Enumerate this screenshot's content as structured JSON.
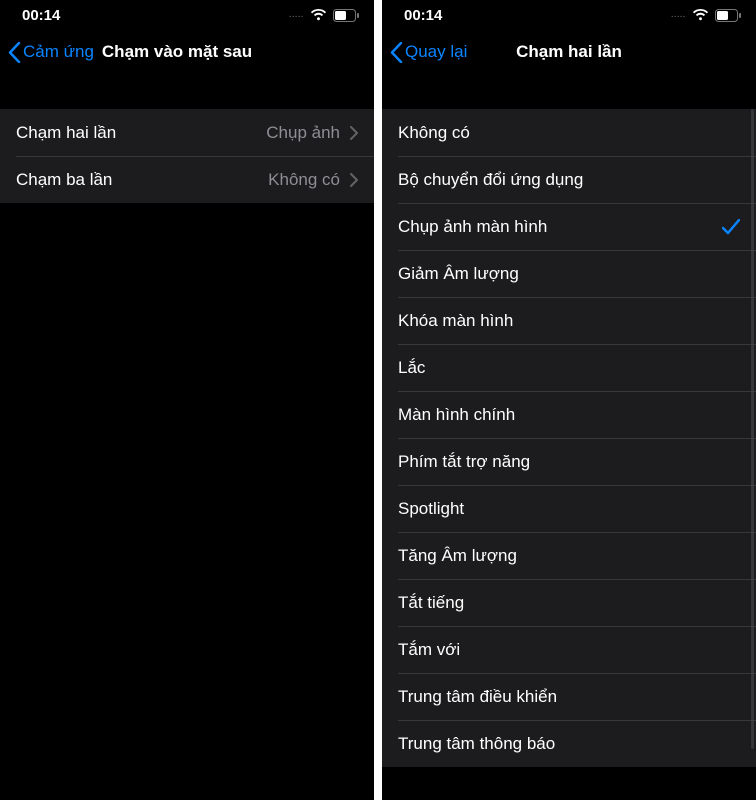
{
  "status": {
    "time": "00:14",
    "dots": "....."
  },
  "screenA": {
    "back_label": "Cảm ứng",
    "title": "Chạm vào mặt sau",
    "rows": [
      {
        "label": "Chạm hai lần",
        "value": "Chụp ảnh"
      },
      {
        "label": "Chạm ba lần",
        "value": "Không có"
      }
    ]
  },
  "screenB": {
    "back_label": "Quay lại",
    "title": "Chạm hai lần",
    "selected_index": 2,
    "options": [
      "Không có",
      "Bộ chuyển đổi ứng dụng",
      "Chụp ảnh màn hình",
      "Giảm Âm lượng",
      "Khóa màn hình",
      "Lắc",
      "Màn hình chính",
      "Phím tắt trợ năng",
      "Spotlight",
      "Tăng Âm lượng",
      "Tắt tiếng",
      "Tắm với",
      "Trung tâm điều khiển",
      "Trung tâm thông báo"
    ]
  }
}
